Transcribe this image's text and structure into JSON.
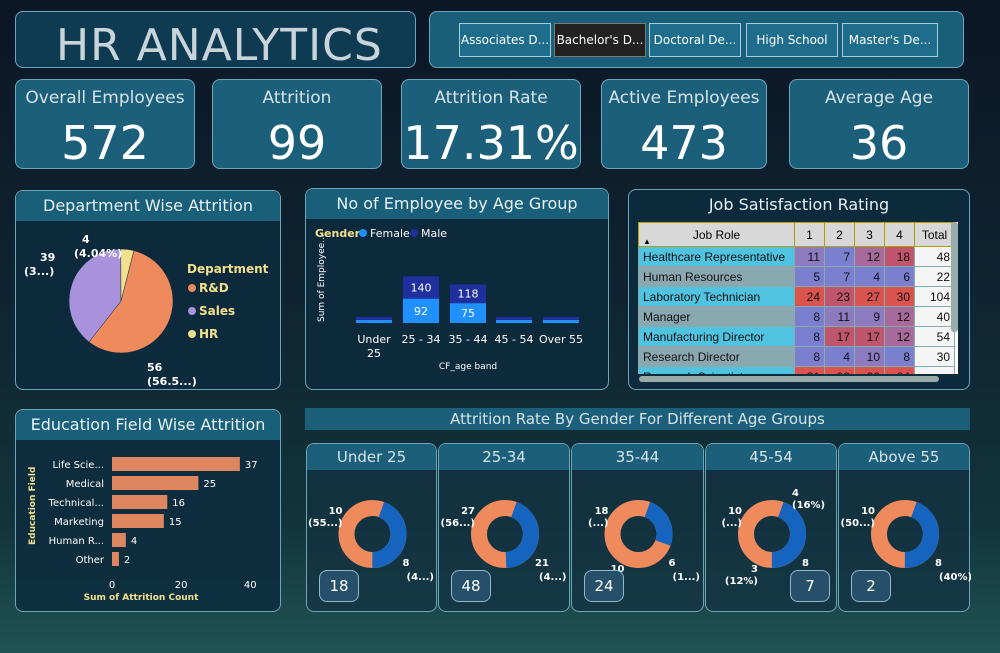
{
  "title": "HR ANALYTICS",
  "slicer": {
    "items": [
      "Associates D...",
      "Bachelor's D...",
      "Doctoral De...",
      "High School",
      "Master's De..."
    ],
    "selected": 1
  },
  "kpis": [
    {
      "label": "Overall Employees",
      "value": "572"
    },
    {
      "label": "Attrition",
      "value": "99"
    },
    {
      "label": "Attrition Rate",
      "value": "17.31%"
    },
    {
      "label": "Active Employees",
      "value": "473"
    },
    {
      "label": "Average Age",
      "value": "36"
    }
  ],
  "dept": {
    "title": "Department Wise Attrition",
    "legend_title": "Department",
    "legend": [
      {
        "name": "R&D",
        "color": "#ee8a5c"
      },
      {
        "name": "Sales",
        "color": "#a892dc"
      },
      {
        "name": "HR",
        "color": "#f2e08c"
      }
    ],
    "labels": [
      {
        "a": "56",
        "b": "(56.5...)"
      },
      {
        "a": "39",
        "b": "(3...)"
      },
      {
        "a": "4",
        "b": "(4.04%)"
      }
    ]
  },
  "age_chart_text": {
    "title": "No of Employee by Age Group",
    "legend_title": "Gender",
    "ylabel": "Sum of Employee...",
    "xlabel": "CF_age band",
    "cat_lines": [
      [
        "Under",
        "25"
      ],
      [
        "25 - 34"
      ],
      [
        "35 - 44"
      ],
      [
        "45 - 54"
      ],
      [
        "Over 55"
      ]
    ]
  },
  "jobsat": {
    "title": "Job Satisfaction Rating",
    "columns": [
      "Job Role",
      "1",
      "2",
      "3",
      "4",
      "Total"
    ],
    "rows": [
      [
        "Healthcare Representative",
        "11",
        "7",
        "12",
        "18",
        "48"
      ],
      [
        "Human Resources",
        "5",
        "7",
        "4",
        "6",
        "22"
      ],
      [
        "Laboratory Technician",
        "24",
        "23",
        "27",
        "30",
        "104"
      ],
      [
        "Manager",
        "8",
        "11",
        "9",
        "12",
        "40"
      ],
      [
        "Manufacturing Director",
        "8",
        "17",
        "17",
        "12",
        "54"
      ],
      [
        "Research Director",
        "8",
        "4",
        "10",
        "8",
        "30"
      ],
      [
        "Research Scientist",
        "31",
        "29",
        "29",
        "24",
        ""
      ]
    ]
  },
  "edu_text": {
    "title": "Education Field Wise Attrition",
    "ylabel": "Education Field",
    "xlabel": "Sum of Attrition Count"
  },
  "gender_age": {
    "title": "Attrition Rate By Gender For Different Age Groups",
    "groups": [
      {
        "title": "Under 25",
        "count": "18",
        "l1": "10",
        "l2": "(55...)",
        "r1": "8",
        "r2": "(4...)"
      },
      {
        "title": "25-34",
        "count": "48",
        "l1": "27",
        "l2": "(56...)",
        "r1": "21",
        "r2": "(4...)"
      },
      {
        "title": "35-44",
        "count": "24",
        "l1": "18",
        "l2": "(...)",
        "r1": "6",
        "r2": "(1...)",
        "b1": "10"
      },
      {
        "title": "45-54",
        "count": "7",
        "l1": "10",
        "l2": "(...)",
        "r1": "8",
        "r2": "",
        "t1": "4",
        "t2": "(16%)",
        "b1": "3",
        "b2": "(12%)"
      },
      {
        "title": "Above 55",
        "count": "2",
        "l1": "10",
        "l2": "(50...)",
        "r1": "8",
        "r2": "(40%)"
      }
    ]
  },
  "chart_data": [
    {
      "type": "pie",
      "title": "Department Wise Attrition",
      "categories": [
        "R&D",
        "Sales",
        "HR"
      ],
      "values": [
        56,
        39,
        4
      ],
      "colors": [
        "#ee8a5c",
        "#a892dc",
        "#f2e08c"
      ]
    },
    {
      "type": "bar",
      "title": "No of Employee by Age Group",
      "categories": [
        "Under 25",
        "25 - 34",
        "35 - 44",
        "45 - 54",
        "Over 55"
      ],
      "series": [
        {
          "name": "Female",
          "color": "#1e90ff",
          "values": [
            5,
            92,
            75,
            9,
            4
          ]
        },
        {
          "name": "Male",
          "color": "#1f2f9e",
          "values": [
            5,
            140,
            118,
            15,
            4
          ]
        }
      ],
      "xlabel": "CF_age band",
      "ylabel": "Sum of Employee..."
    },
    {
      "type": "bar",
      "title": "Education Field Wise Attrition",
      "categories": [
        "Life Scie...",
        "Medical",
        "Technical...",
        "Marketing",
        "Human R...",
        "Other"
      ],
      "values": [
        37,
        25,
        16,
        15,
        4,
        2
      ],
      "color": "#dd8660",
      "xlim": [
        0,
        40
      ],
      "xticks": [
        0,
        20,
        40
      ],
      "xlabel": "Sum of Attrition Count",
      "ylabel": "Education Field"
    },
    {
      "type": "pie",
      "title": "Attrition Rate By Gender For Different Age Groups",
      "groups": [
        "Under 25",
        "25-34",
        "35-44",
        "45-54",
        "Above 55"
      ],
      "series": [
        {
          "name": "Male",
          "color": "#ee8a5c",
          "values": [
            10,
            27,
            18,
            10,
            10
          ]
        },
        {
          "name": "Female",
          "color": "#1565c0",
          "values": [
            8,
            21,
            6,
            8,
            8
          ]
        }
      ]
    }
  ]
}
